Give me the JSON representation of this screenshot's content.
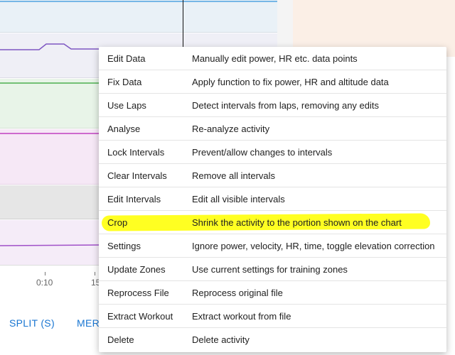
{
  "chart": {
    "ticks": [
      "0:10",
      "15"
    ],
    "colors": {
      "line_top": "#4fa3e0",
      "line_purple": "#7e57c2",
      "line_green": "#4caf50",
      "line_magenta": "#c040c0",
      "line_violet": "#a050c8"
    }
  },
  "actions": {
    "split_label": "SPLIT (S)",
    "merge_label": "MER"
  },
  "menu": {
    "items": [
      {
        "label": "Edit Data",
        "description": "Manually edit power, HR etc. data points"
      },
      {
        "label": "Fix Data",
        "description": "Apply function to fix power, HR and altitude data"
      },
      {
        "label": "Use Laps",
        "description": "Detect intervals from laps, removing any edits"
      },
      {
        "label": "Analyse",
        "description": "Re-analyze activity"
      },
      {
        "label": "Lock Intervals",
        "description": "Prevent/allow changes to intervals"
      },
      {
        "label": "Clear Intervals",
        "description": "Remove all intervals"
      },
      {
        "label": "Edit Intervals",
        "description": "Edit all visible intervals"
      },
      {
        "label": "Crop",
        "description": "Shrink the activity to the portion shown on the chart",
        "highlighted": true
      },
      {
        "label": "Settings",
        "description": "Ignore power, velocity, HR, time, toggle elevation correction"
      },
      {
        "label": "Update Zones",
        "description": "Use current settings for training zones"
      },
      {
        "label": "Reprocess File",
        "description": "Reprocess original file"
      },
      {
        "label": "Extract Workout",
        "description": "Extract workout from file"
      },
      {
        "label": "Delete",
        "description": "Delete activity"
      }
    ],
    "highlight_color": "#ffff22"
  }
}
